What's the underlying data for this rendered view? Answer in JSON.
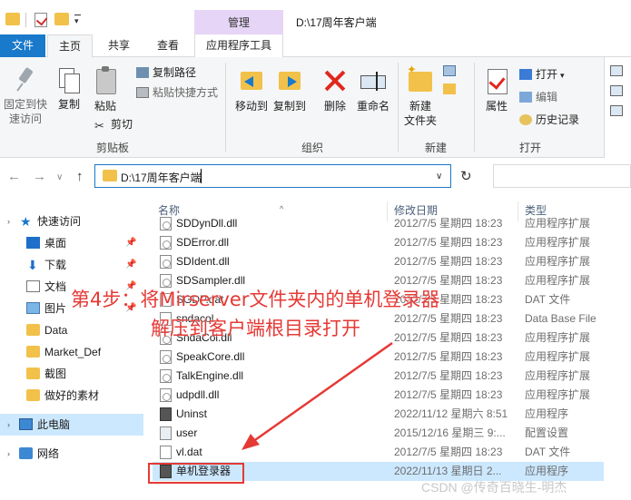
{
  "window": {
    "title": "D:\\17周年客户端",
    "context_tab_header": "管理"
  },
  "ribbon_tabs": [
    "文件",
    "主页",
    "共享",
    "查看",
    "应用程序工具"
  ],
  "ribbon": {
    "clipboard": {
      "pin_quick_access": "固定到快\n速访问",
      "copy": "复制",
      "paste": "粘贴",
      "copy_path": "复制路径",
      "paste_shortcut": "粘贴快捷方式",
      "cut": "剪切",
      "group_label": "剪贴板"
    },
    "organize": {
      "move_to": "移动到",
      "copy_to": "复制到",
      "delete": "删除",
      "rename": "重命名",
      "group_label": "组织"
    },
    "new": {
      "new_folder": "新建\n文件夹",
      "group_label": "新建"
    },
    "open": {
      "properties": "属性",
      "open": "打开",
      "edit": "编辑",
      "history": "历史记录",
      "group_label": "打开"
    }
  },
  "address": {
    "path": "D:\\17周年客户端"
  },
  "nav_pane": {
    "items": [
      {
        "label": "快速访问",
        "icon": "star-icon"
      },
      {
        "label": "桌面",
        "icon": "desktop-icon",
        "pinned": true
      },
      {
        "label": "下载",
        "icon": "download-icon",
        "pinned": true
      },
      {
        "label": "文档",
        "icon": "document-icon",
        "pinned": true
      },
      {
        "label": "图片",
        "icon": "picture-icon",
        "pinned": true
      },
      {
        "label": "Data",
        "icon": "folder-icon"
      },
      {
        "label": "Market_Def",
        "icon": "folder-icon"
      },
      {
        "label": "截图",
        "icon": "folder-icon"
      },
      {
        "label": "做好的素材",
        "icon": "folder-icon"
      },
      {
        "label": "此电脑",
        "icon": "computer-icon"
      },
      {
        "label": "网络",
        "icon": "network-icon"
      }
    ]
  },
  "file_list": {
    "columns": [
      "名称",
      "修改日期",
      "类型"
    ],
    "rows": [
      {
        "name": "SDDynDll.dll",
        "date": "2012/7/5 星期四 18:23",
        "type": "应用程序扩展",
        "kind": "dll"
      },
      {
        "name": "SDError.dll",
        "date": "2012/7/5 星期四 18:23",
        "type": "应用程序扩展",
        "kind": "dll"
      },
      {
        "name": "SDIdent.dll",
        "date": "2012/7/5 星期四 18:23",
        "type": "应用程序扩展",
        "kind": "dll"
      },
      {
        "name": "SDSampler.dll",
        "date": "2012/7/5 星期四 18:23",
        "type": "应用程序扩展",
        "kind": "dll"
      },
      {
        "name": "SGDP.dat",
        "date": "2012/7/5 星期四 18:23",
        "type": "DAT 文件",
        "kind": "dat"
      },
      {
        "name": "sndacol",
        "date": "2012/7/5 星期四 18:23",
        "type": "Data Base File",
        "kind": "dat"
      },
      {
        "name": "SndaCol.dll",
        "date": "2012/7/5 星期四 18:23",
        "type": "应用程序扩展",
        "kind": "dll"
      },
      {
        "name": "SpeakCore.dll",
        "date": "2012/7/5 星期四 18:23",
        "type": "应用程序扩展",
        "kind": "dll"
      },
      {
        "name": "TalkEngine.dll",
        "date": "2012/7/5 星期四 18:23",
        "type": "应用程序扩展",
        "kind": "dll"
      },
      {
        "name": "udpdll.dll",
        "date": "2012/7/5 星期四 18:23",
        "type": "应用程序扩展",
        "kind": "dll"
      },
      {
        "name": "Uninst",
        "date": "2022/11/12 星期六 8:51",
        "type": "应用程序",
        "kind": "exe"
      },
      {
        "name": "user",
        "date": "2015/12/16 星期三 9:...",
        "type": "配置设置",
        "kind": "ini"
      },
      {
        "name": "vl.dat",
        "date": "2012/7/5 星期四 18:23",
        "type": "DAT 文件",
        "kind": "dat"
      },
      {
        "name": "单机登录器",
        "date": "2022/11/13 星期日 2...",
        "type": "应用程序",
        "kind": "exe"
      }
    ]
  },
  "annotation": {
    "line1": "第4步：将Mirserver文件夹内的单机登录器",
    "line2": "解压到客户端根目录打开",
    "color": "#e53935"
  },
  "watermark": "CSDN @传奇百晓生-明杰"
}
